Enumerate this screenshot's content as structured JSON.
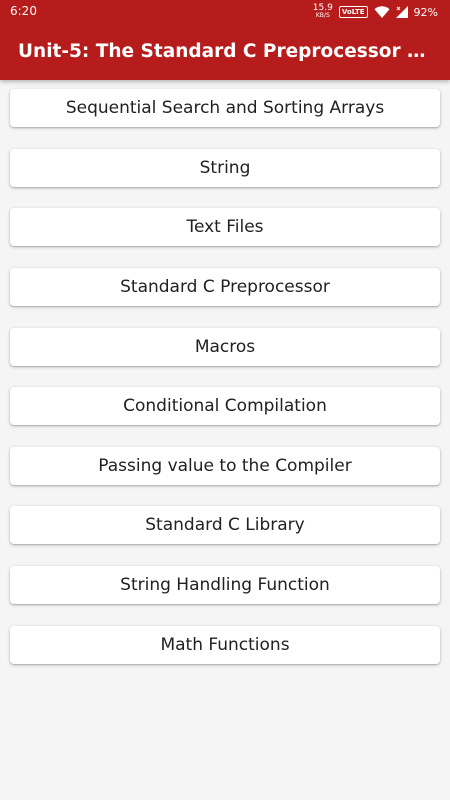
{
  "status_bar": {
    "time": "6:20",
    "net_speed_value": "15.9",
    "net_speed_unit": "KB/S",
    "volte": "VoLTE",
    "battery_pct": "92%"
  },
  "app_bar": {
    "title": "Unit-5: The Standard C Preprocessor and C..."
  },
  "topics": [
    "Sequential Search and Sorting Arrays",
    "String",
    "Text Files",
    "Standard C Preprocessor",
    "Macros",
    "Conditional Compilation",
    "Passing value to the Compiler",
    "Standard C Library",
    "String Handling Function",
    "Math Functions"
  ]
}
